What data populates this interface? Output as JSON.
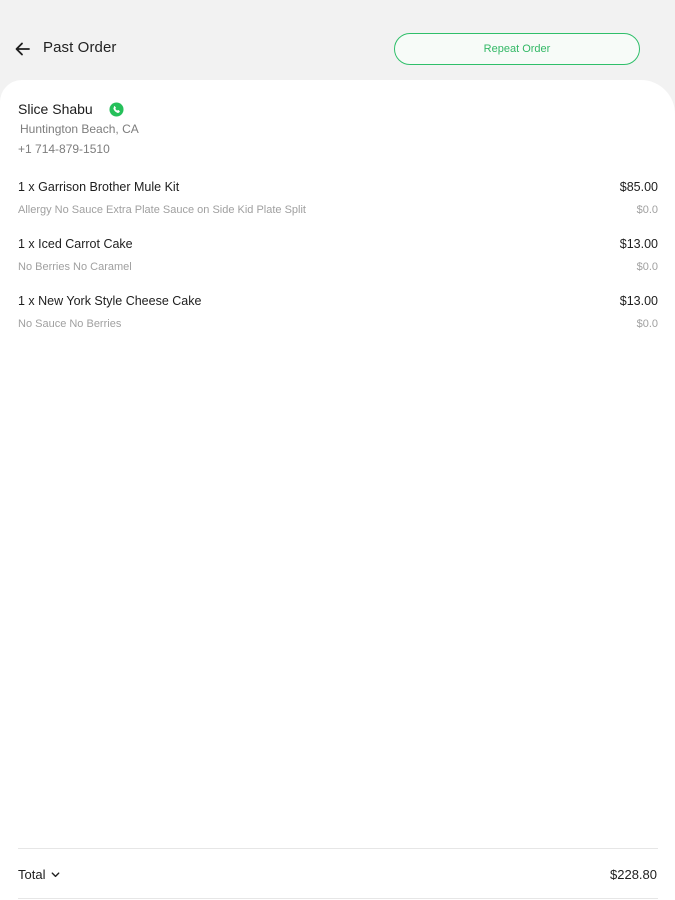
{
  "header": {
    "title": "Past Order",
    "repeat_label": "Repeat Order"
  },
  "store": {
    "name": "Slice Shabu",
    "location": "Huntington Beach, CA",
    "phone": "+1 714-879-1510"
  },
  "items": [
    {
      "name": "1 x Garrison Brother Mule Kit",
      "price": "$85.00",
      "modifiers": "Allergy No Sauce Extra Plate Sauce on Side Kid Plate Split",
      "modifiers_price": "$0.0"
    },
    {
      "name": "1 x Iced Carrot Cake",
      "price": "$13.00",
      "modifiers": "No Berries No Caramel",
      "modifiers_price": "$0.0"
    },
    {
      "name": "1 x New York Style Cheese Cake",
      "price": "$13.00",
      "modifiers": "No Sauce No Berries",
      "modifiers_price": "$0.0"
    }
  ],
  "summary": {
    "total_label": "Total",
    "total_value": "$228.80"
  },
  "colors": {
    "accent_green": "#2fbf6a",
    "phone_icon_green": "#25c05a"
  },
  "icons": {
    "back": "arrow-left-icon",
    "phone": "phone-icon",
    "expand": "chevron-down-icon"
  }
}
